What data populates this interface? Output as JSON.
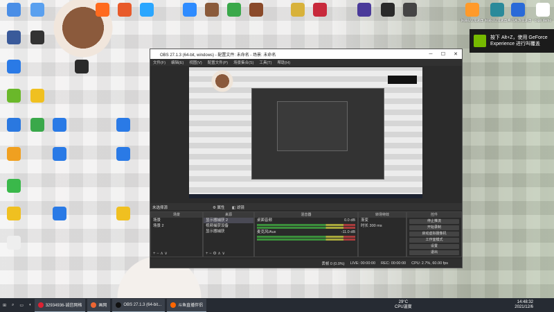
{
  "desktop": {
    "icons": [
      {
        "label": "",
        "color": "#4a8ee6"
      },
      {
        "label": "",
        "color": "#5aa0ef"
      },
      {
        "label": "",
        "color": "#ff6a1e"
      },
      {
        "label": "",
        "color": "#e85a2a"
      },
      {
        "label": "",
        "color": "#2aa6ff"
      },
      {
        "label": "",
        "color": "#2e8bff"
      },
      {
        "label": "",
        "color": "#8a5a3a"
      },
      {
        "label": "",
        "color": "#3aa84a"
      },
      {
        "label": "",
        "color": "#8a4a2a"
      },
      {
        "label": "",
        "color": "#d8b23a"
      },
      {
        "label": "",
        "color": "#c8293b"
      },
      {
        "label": "",
        "color": "#4a3a9a"
      },
      {
        "label": "",
        "color": "#2a2a2a"
      },
      {
        "label": "",
        "color": "#444"
      },
      {
        "label": "",
        "color": "#ff9a2a"
      },
      {
        "label": "",
        "color": "#2a8a9a"
      },
      {
        "label": "",
        "color": "#2a6ad8"
      },
      {
        "label": "",
        "color": "#ffffff"
      },
      {
        "label": "",
        "color": "#3a5a9a"
      },
      {
        "label": "",
        "color": "#333"
      },
      {
        "label": "",
        "color": "#2a7ae6"
      },
      {
        "label": "",
        "color": "#2a2a2a"
      },
      {
        "label": "",
        "color": "#6ab82a"
      },
      {
        "label": "",
        "color": "#f0c020"
      },
      {
        "label": "",
        "color": "#2a78e0"
      },
      {
        "label": "",
        "color": "#3aa84a"
      },
      {
        "label": "",
        "color": "#2a7ae6"
      },
      {
        "label": "",
        "color": "#2a7ae6"
      },
      {
        "label": "",
        "color": "#f0a020"
      },
      {
        "label": "",
        "color": "#2a7ae6"
      },
      {
        "label": "",
        "color": "#2a7ae6"
      },
      {
        "label": "",
        "color": "#3ab84a"
      },
      {
        "label": "",
        "color": "#f0c020"
      },
      {
        "label": "",
        "color": "#2a7ae6"
      },
      {
        "label": "",
        "color": "#f0c020"
      },
      {
        "label": "",
        "color": "#eee"
      }
    ],
    "top_right_labels": [
      "网易UU加速器",
      "网易UU加速器",
      "腾讯网游加速器",
      "csgo demo"
    ]
  },
  "toast": {
    "text": "按下 Alt+Z，使用 GeForce Experience 进行叫覆盖"
  },
  "obs": {
    "title": "OBS 27.1.3 (64-bit, windows) - 配置文件: 未命名 - 场景: 未命名",
    "menu": [
      "文件(F)",
      "编辑(E)",
      "视图(V)",
      "配置文件(P)",
      "场景集合(S)",
      "工具(T)",
      "帮助(H)"
    ],
    "source_label": "未选择源",
    "ctrl": {
      "props": "属性",
      "filters": "滤镜"
    },
    "docks": {
      "scenes": {
        "title": "场景",
        "items": [
          "场景",
          "场景 2"
        ]
      },
      "sources": {
        "title": "来源",
        "items": [
          "显示器捕获 2",
          "视频捕获设备",
          "显示器捕获"
        ]
      },
      "mixer": {
        "title": "混音器",
        "ch1": "桌面音频",
        "ch1_db": "0.0 dB",
        "ch2": "麦克风/Aux",
        "ch2_db": "-11.0 dB"
      },
      "transitions": {
        "title": "转场特效",
        "fade": "渐变",
        "duration_label": "时长",
        "duration": "300 ms"
      },
      "controls": {
        "title": "控件",
        "buttons": [
          "停止推流",
          "开始录制",
          "启动虚拟摄像机",
          "工作室模式",
          "设置",
          "退出"
        ]
      }
    },
    "status": {
      "drops": "丢帧 0 (0.0%)",
      "live": "LIVE: 00:00:00",
      "rec": "REC: 00:00:00",
      "cpu": "CPU: 2.7%, 60.00 fps"
    }
  },
  "taskbar": {
    "apps": [
      {
        "label": "32934936-诚信网格",
        "color": "#d23"
      },
      {
        "label": "画网",
        "color": "#e63"
      },
      {
        "label": "OBS 27.1.3 (64-bit...",
        "color": "#111"
      },
      {
        "label": "斗鱼直播伴侣",
        "color": "#f60"
      }
    ],
    "weather": {
      "temp": "29°C",
      "desc": "CPU温度"
    },
    "clock": {
      "time": "14:48:32",
      "date": "2021/12/6"
    }
  }
}
